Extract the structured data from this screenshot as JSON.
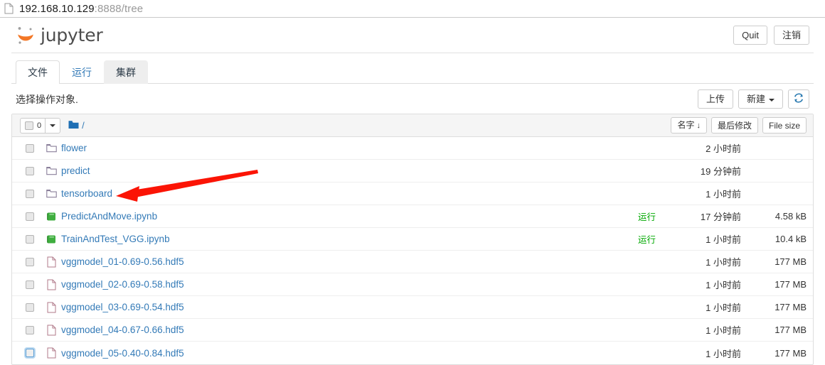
{
  "browser": {
    "url_host": "192.168.10.129",
    "url_path": ":8888/tree",
    "page_icon": "page-icon"
  },
  "header": {
    "logo_text": "jupyter",
    "quit_label": "Quit",
    "logout_label": "注销"
  },
  "tabs": [
    {
      "label": "文件",
      "state": "active"
    },
    {
      "label": "运行",
      "state": "normal"
    },
    {
      "label": "集群",
      "state": "hover"
    }
  ],
  "toolbar": {
    "select_note": "选择操作对象.",
    "upload_label": "上传",
    "new_label": "新建",
    "refresh_icon": "refresh-icon"
  },
  "list_header": {
    "selected_count": "0",
    "breadcrumb_path": "/",
    "folder_icon": "folder-icon",
    "sort_name": "名字",
    "sort_name_arrow": "↓",
    "sort_modified": "最后修改",
    "sort_size": "File size"
  },
  "colors": {
    "link": "#337ab7",
    "brand_orange": "#f37726",
    "running_green": "#00a800",
    "folder_blue": "#1f6fb4",
    "notebook_green": "#44aa44",
    "arrow_red": "#fb1405"
  },
  "rows": [
    {
      "icon": "folder-icon",
      "name": "flower",
      "running": "",
      "modified": "2 小时前",
      "size": ""
    },
    {
      "icon": "folder-icon",
      "name": "predict",
      "running": "",
      "modified": "19 分钟前",
      "size": ""
    },
    {
      "icon": "folder-icon",
      "name": "tensorboard",
      "running": "",
      "modified": "1 小时前",
      "size": ""
    },
    {
      "icon": "notebook-icon",
      "name": "PredictAndMove.ipynb",
      "running": "运行",
      "modified": "17 分钟前",
      "size": "4.58 kB"
    },
    {
      "icon": "notebook-icon",
      "name": "TrainAndTest_VGG.ipynb",
      "running": "运行",
      "modified": "1 小时前",
      "size": "10.4 kB"
    },
    {
      "icon": "file-icon",
      "name": "vggmodel_01-0.69-0.56.hdf5",
      "running": "",
      "modified": "1 小时前",
      "size": "177 MB"
    },
    {
      "icon": "file-icon",
      "name": "vggmodel_02-0.69-0.58.hdf5",
      "running": "",
      "modified": "1 小时前",
      "size": "177 MB"
    },
    {
      "icon": "file-icon",
      "name": "vggmodel_03-0.69-0.54.hdf5",
      "running": "",
      "modified": "1 小时前",
      "size": "177 MB"
    },
    {
      "icon": "file-icon",
      "name": "vggmodel_04-0.67-0.66.hdf5",
      "running": "",
      "modified": "1 小时前",
      "size": "177 MB"
    },
    {
      "icon": "file-icon",
      "name": "vggmodel_05-0.40-0.84.hdf5",
      "running": "",
      "modified": "1 小时前",
      "size": "177 MB",
      "checkbox_focused": true
    }
  ],
  "annotation": {
    "type": "arrow",
    "points_at": "tensorboard",
    "color": "#fb1405"
  }
}
